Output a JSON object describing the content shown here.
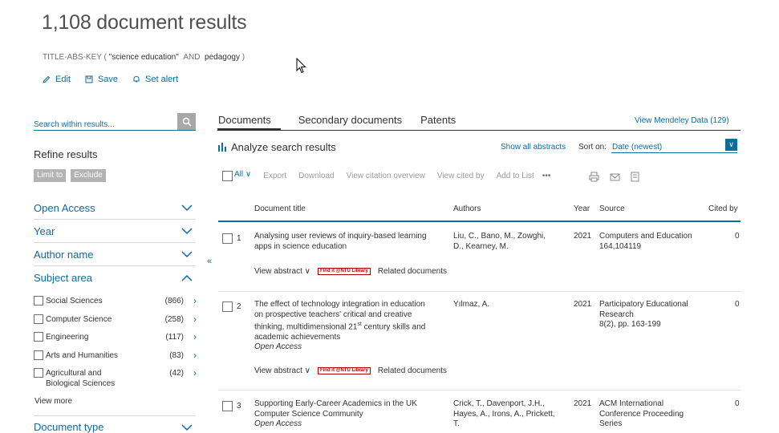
{
  "header": {
    "title": "1,108 document results",
    "query": {
      "field": "TITLE-ABS-KEY",
      "open": "(",
      "term1": "\"science education\"",
      "operator": "AND",
      "term2": "pedagogy",
      "close": ")"
    },
    "actions": {
      "edit": "Edit",
      "save": "Save",
      "alert": "Set alert"
    }
  },
  "sidebar": {
    "search_placeholder": "Search within results...",
    "refine_title": "Refine results",
    "limit_to": "Limit to",
    "exclude": "Exclude",
    "facets": [
      {
        "label": "Open Access",
        "expanded": false
      },
      {
        "label": "Year",
        "expanded": false
      },
      {
        "label": "Author name",
        "expanded": false
      },
      {
        "label": "Subject area",
        "expanded": true
      }
    ],
    "subjects": [
      {
        "label": "Social Sciences",
        "count": "(866)"
      },
      {
        "label": "Computer Science",
        "count": "(258)"
      },
      {
        "label": "Engineering",
        "count": "(117)"
      },
      {
        "label": "Arts and Humanities",
        "count": "(83)"
      },
      {
        "label": "Agricultural and",
        "label2": "Biological Sciences",
        "count": "(42)"
      }
    ],
    "view_more": "View more",
    "document_type": "Document type"
  },
  "main": {
    "tabs": [
      "Documents",
      "Secondary documents",
      "Patents"
    ],
    "mendeley": "View Mendeley Data (129)",
    "analyze": "Analyze search results",
    "show_abstracts": "Show all abstracts",
    "sort_label": "Sort on:",
    "sort_value": "Date (newest)",
    "toolbar": {
      "all": "All",
      "export": "Export",
      "download": "Download",
      "citation_overview": "View citation overview",
      "cited_by": "View cited by",
      "add_to_list": "Add to List",
      "more": "•••"
    },
    "columns": {
      "title": "Document title",
      "authors": "Authors",
      "year": "Year",
      "source": "Source",
      "cited": "Cited by"
    },
    "view_abstract": "View abstract",
    "findit": "Find it @NTU Library",
    "related": "Related documents",
    "results": [
      {
        "num": "1",
        "title_lines": [
          "Analysing user reviews of inquiry-based learning",
          "apps in science education"
        ],
        "open_access": "",
        "authors": [
          "Liu, C., Bano, M., Zowghi,",
          "D., Kearney, M."
        ],
        "year": "2021",
        "source": [
          "Computers and Education",
          "164,104119"
        ],
        "cited": "0"
      },
      {
        "num": "2",
        "title_lines": [
          "The effect of technology integration in education",
          "on prospective teachers' critical and creative",
          "thinking, multidimensional 21",
          "st",
          " century skills and",
          "academic achievements"
        ],
        "open_access": "Open Access",
        "authors": [
          "Yılmaz, A."
        ],
        "year": "2021",
        "source": [
          "Participatory Educational",
          "Research",
          "8(2), pp. 163-199"
        ],
        "cited": "0"
      },
      {
        "num": "3",
        "title_lines": [
          "Supporting Early-Career Academics in the UK",
          "Computer Science Community"
        ],
        "open_access": "Open Access",
        "authors": [
          "Crick, T., Davenport, J.H.,",
          "Hayes, A., Irons, A., Prickett,",
          "T."
        ],
        "year": "2021",
        "source": [
          "ACM International",
          "Conference Proceeding",
          "Series"
        ],
        "cited": "0"
      }
    ]
  }
}
